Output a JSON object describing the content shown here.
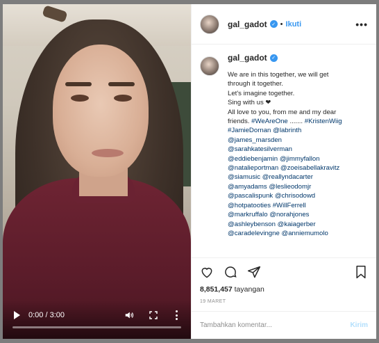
{
  "video": {
    "time_display": "0:00 / 3:00",
    "progress": 0,
    "icons": {
      "play": "play-icon",
      "volume": "volume-icon",
      "fullscreen": "fullscreen-icon",
      "more": "more-vertical-icon"
    }
  },
  "header": {
    "username": "gal_gadot",
    "separator": "•",
    "follow_label": "Ikuti",
    "more_label": "•••"
  },
  "caption": {
    "username": "gal_gadot",
    "lines": [
      "We are in this together, we will get",
      "through it together.",
      "Let's imagine together.",
      "Sing with us ❤",
      "All love to you, from me and my dear",
      "friends. #WeAreOne ....... #KristenWiig",
      "#JamieDornan @labrinth",
      "@james_marsden",
      "@sarahkatesilverman",
      "@eddiebenjamin @jimmyfallon",
      "@natalieportman @zoeisabellakravitz",
      "@siamusic @reallyndacarter",
      "@amyadams @leslieodomjr",
      "@pascalispunk @chrisodowd",
      "@hotpatooties #WillFerrell",
      "@markruffalo @norahjones",
      "@ashleybenson @kaiagerber",
      "@caradelevingne @anniemumolo"
    ]
  },
  "stats": {
    "views_count": "8,851,457",
    "views_label": "tayangan",
    "date": "19 MARET"
  },
  "comment_box": {
    "placeholder": "Tambahkan komentar...",
    "post_label": "Kirim"
  },
  "colors": {
    "accent": "#3897f0",
    "link": "#00376b",
    "muted": "#8e8e8e",
    "post_disabled": "#b2dffc"
  }
}
